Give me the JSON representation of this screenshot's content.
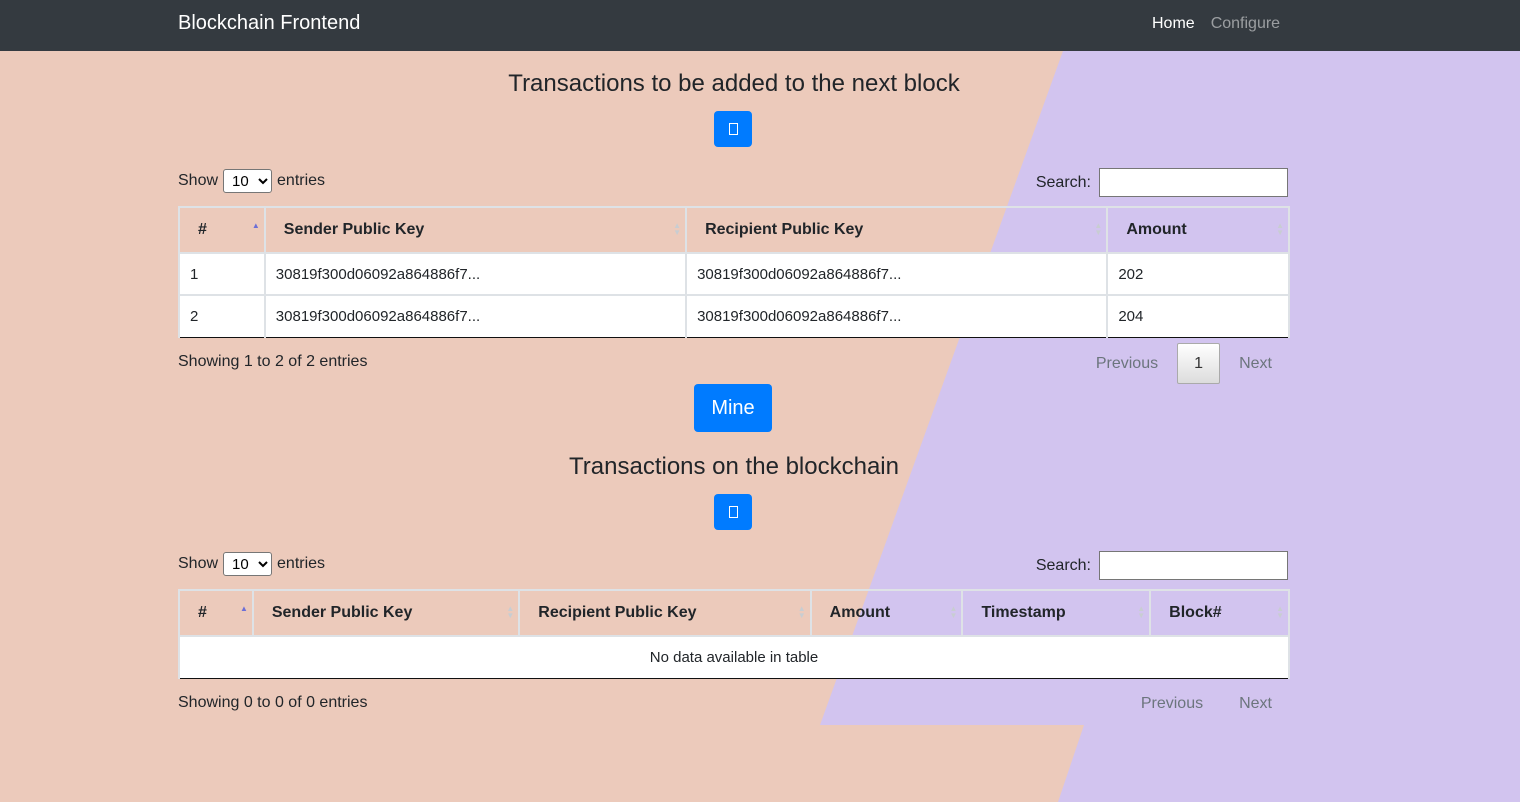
{
  "navbar": {
    "brand": "Blockchain Frontend",
    "links": [
      {
        "label": "Home",
        "active": true
      },
      {
        "label": "Configure",
        "active": false
      }
    ]
  },
  "pending": {
    "title": "Transactions to be added to the next block",
    "show_prefix": "Show",
    "show_value": "10",
    "show_suffix": "entries",
    "search_label": "Search:",
    "search_value": "",
    "columns": [
      "#",
      "Sender Public Key",
      "Recipient Public Key",
      "Amount"
    ],
    "rows": [
      [
        "1",
        "30819f300d06092a864886f7...",
        "30819f300d06092a864886f7...",
        "202"
      ],
      [
        "2",
        "30819f300d06092a864886f7...",
        "30819f300d06092a864886f7...",
        "204"
      ]
    ],
    "info": "Showing 1 to 2 of 2 entries",
    "prev": "Previous",
    "page": "1",
    "next": "Next"
  },
  "mine_label": "Mine",
  "chain": {
    "title": "Transactions on the blockchain",
    "show_prefix": "Show",
    "show_value": "10",
    "show_suffix": "entries",
    "search_label": "Search:",
    "search_value": "",
    "columns": [
      "#",
      "Sender Public Key",
      "Recipient Public Key",
      "Amount",
      "Timestamp",
      "Block#"
    ],
    "empty": "No data available in table",
    "info": "Showing 0 to 0 of 0 entries",
    "prev": "Previous",
    "next": "Next"
  },
  "colors": {
    "navbar": "#343a40",
    "peach": "#eccabb",
    "lavender": "#d2c4ef",
    "primary": "#007bff"
  }
}
